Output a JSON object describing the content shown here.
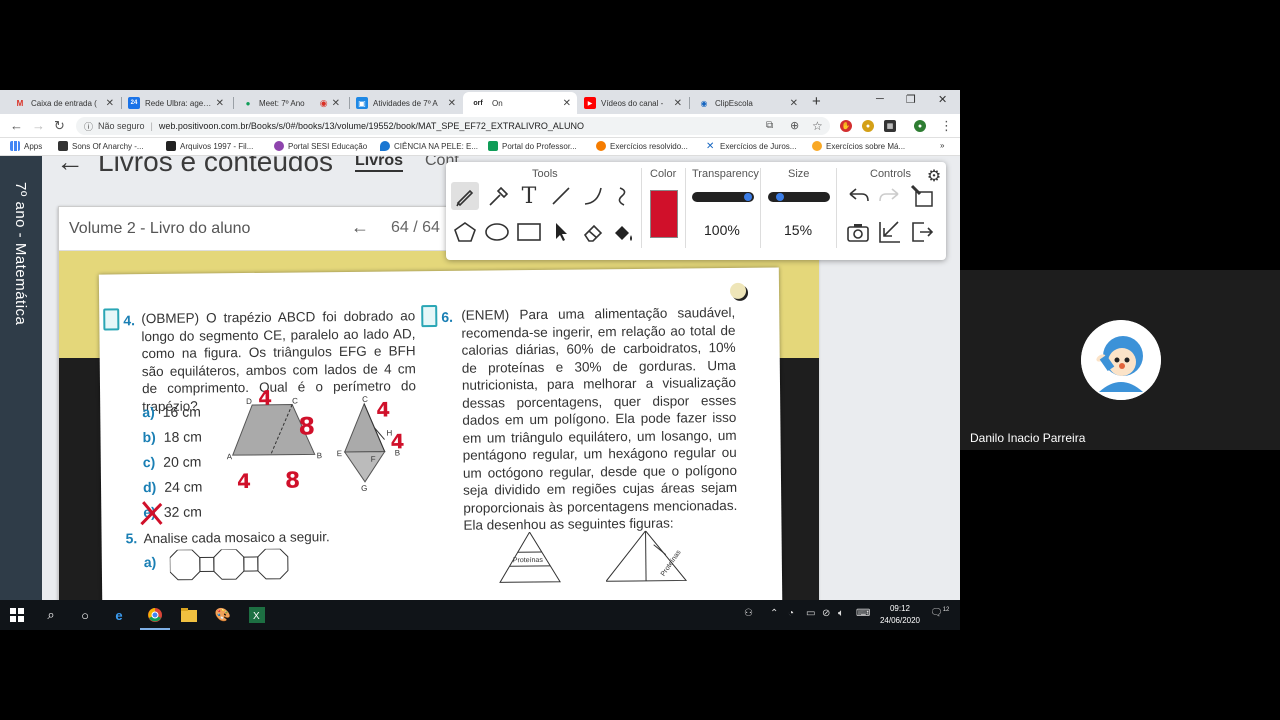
{
  "browser": {
    "tabs": [
      {
        "label": "Caixa de entrada (",
        "favicon": "M",
        "color": "#d93025"
      },
      {
        "label": "Rede Ulbra: agend",
        "favicon": "24",
        "color": "#1a73e8"
      },
      {
        "label": "Meet: 7º Ano",
        "favicon": "●",
        "color": "#0f9d58"
      },
      {
        "label": "Atividades de 7º A",
        "favicon": "▣",
        "color": "#1e88e5"
      },
      {
        "label": "On",
        "favicon": "orf",
        "color": "#222222"
      },
      {
        "label": "Vídeos do canal -",
        "favicon": "▶",
        "color": "#ff0000"
      },
      {
        "label": "ClipEscola",
        "favicon": "◉",
        "color": "#1565c0"
      }
    ],
    "security_label": "Não seguro",
    "url": "web.positivoon.com.br/Books/s/0#/books/13/volume/19552/book/MAT_SPE_EF72_EXTRALIVRO_ALUNO",
    "bookmarks": [
      "Apps",
      "Sons Of Anarchy -...",
      "Arquivos 1997 - Fil...",
      "Portal SESI Educação",
      "CIÊNCIA NA PELE: E...",
      "Portal do Professor...",
      "Exercícios resolvido...",
      "Exercícios de Juros...",
      "Exercícios sobre Má..."
    ]
  },
  "page": {
    "sidebar_label": "7º ano - Matemática",
    "title": "Livros e conteúdos",
    "tab_books": "Livros",
    "tab_content": "Cont",
    "volume": "Volume 2 - Livro do aluno",
    "page_current": "64",
    "page_total": "/ 64"
  },
  "questions": {
    "q4": {
      "number": "4.",
      "text": "(OBMEP) O trapézio ABCD foi dobrado ao longo do segmento CE, paralelo ao lado AD, como na figura. Os triângulos EFG e BFH são equiláteros, ambos com lados de 4 cm de comprimento. Qual é o perímetro do trapézio?",
      "options": [
        {
          "letter": "a)",
          "value": "16 cm"
        },
        {
          "letter": "b)",
          "value": "18 cm"
        },
        {
          "letter": "c)",
          "value": "20 cm"
        },
        {
          "letter": "d)",
          "value": "24 cm"
        },
        {
          "letter": "e)",
          "value": "32 cm"
        }
      ]
    },
    "q5": {
      "number": "5.",
      "text": "Analise cada mosaico a seguir.",
      "option": "a)"
    },
    "q6": {
      "number": "6.",
      "text": "(ENEM) Para uma alimentação saudável, recomenda-se ingerir, em relação ao total de calorias diárias, 60% de carboidratos, 10% de proteínas e 30% de gorduras. Uma nutricionista, para melhorar a visualização dessas porcentagens, quer dispor esses dados em um polígono. Ela pode fazer isso em um triângulo equilátero, um losango, um pentágono regular, um hexágono regular ou um octógono regular, desde que o polígono seja dividido em regiões cujas áreas sejam proporcionais às porcentagens mencionadas. Ela desenhou as seguintes figuras:",
      "figure_label_1": "Proteínas",
      "figure_label_2": "Proteínas"
    },
    "handwriting": {
      "top": "4",
      "right": "8",
      "bottom_left": "4",
      "bottom_mid": "8",
      "fig2_top": "4",
      "fig2_right": "4"
    },
    "figure_vertices": {
      "A": "A",
      "B": "B",
      "C": "C",
      "D": "D",
      "E": "E",
      "F": "F",
      "G": "G",
      "H": "H"
    }
  },
  "annotator": {
    "tools_label": "Tools",
    "color_label": "Color",
    "transparency_label": "Transparency",
    "size_label": "Size",
    "controls_label": "Controls",
    "transparency_value": "100%",
    "size_value": "15%",
    "current_color": "#d0102a"
  },
  "taskbar": {
    "time": "09:12",
    "date": "24/06/2020",
    "notifications": "12"
  },
  "meeting": {
    "participant_name": "Danilo Inacio Parreira"
  }
}
